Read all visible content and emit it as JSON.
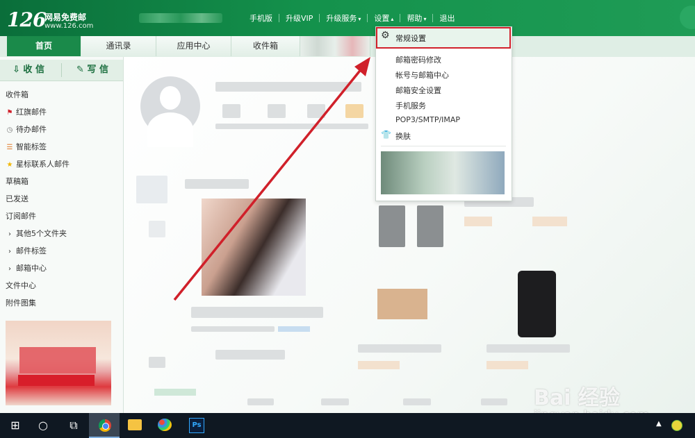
{
  "header": {
    "logo_number": "126",
    "logo_title": "网易免费邮",
    "logo_url": "www.126.com",
    "nav": [
      {
        "label": "手机版",
        "caret": false
      },
      {
        "label": "升级VIP",
        "caret": false
      },
      {
        "label": "升级服务",
        "caret": "down"
      },
      {
        "label": "设置",
        "caret": "up"
      },
      {
        "label": "帮助",
        "caret": "down"
      },
      {
        "label": "退出",
        "caret": false
      }
    ]
  },
  "tabs": [
    "首页",
    "通讯录",
    "应用中心",
    "收件箱"
  ],
  "sidebar": {
    "receive_label": "收 信",
    "write_label": "写 信",
    "items": [
      {
        "label": "收件箱",
        "icon": ""
      },
      {
        "label": "红旗邮件",
        "icon": "red-flag-icon"
      },
      {
        "label": "待办邮件",
        "icon": "clock-icon"
      },
      {
        "label": "智能标签",
        "icon": "tag-stripes-icon"
      },
      {
        "label": "星标联系人邮件",
        "icon": "star-icon"
      },
      {
        "label": "草稿箱",
        "icon": ""
      },
      {
        "label": "已发送",
        "icon": ""
      },
      {
        "label": "订阅邮件",
        "icon": ""
      },
      {
        "label": "其他5个文件夹",
        "icon": "chevron-right-icon"
      },
      {
        "label": "邮件标签",
        "icon": "chevron-right-icon"
      },
      {
        "label": "邮箱中心",
        "icon": "chevron-right-icon"
      },
      {
        "label": "文件中心",
        "icon": ""
      },
      {
        "label": "附件图集",
        "icon": ""
      }
    ]
  },
  "settings_menu": {
    "highlighted": "常规设置",
    "items": [
      "邮箱密码修改",
      "帐号与邮箱中心",
      "邮箱安全设置",
      "手机服务",
      "POP3/SMTP/IMAP",
      "换肤"
    ]
  },
  "watermark": {
    "logo": "Bai 经验",
    "url": "jingyan.baidu.com"
  },
  "taskbar": {
    "ps_label": "Ps"
  },
  "colors": {
    "brand_green": "#14924c",
    "highlight_red": "#d0202a"
  }
}
